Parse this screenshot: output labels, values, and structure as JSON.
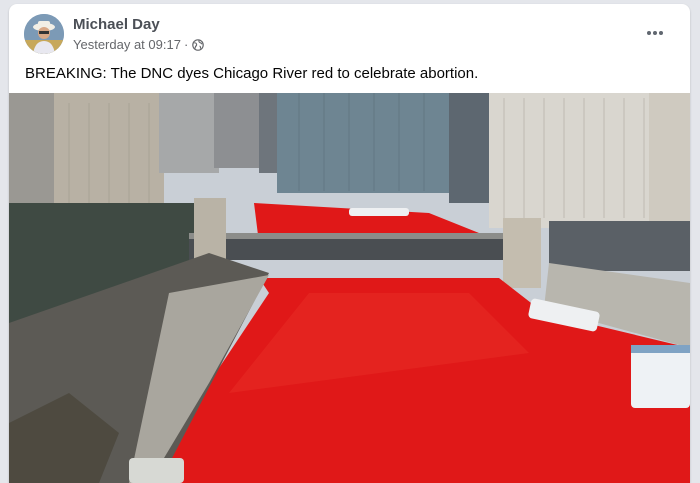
{
  "post": {
    "author_name": "Michael Day",
    "timestamp": "Yesterday at 09:17",
    "separator": "·",
    "audience_icon": "globe-icon",
    "more_icon": "more-options-icon",
    "text": "BREAKING: The DNC dyes Chicago River red to celebrate abortion."
  },
  "photo": {
    "water_color": "#e01818",
    "sky_color": "#c9cfd6"
  }
}
